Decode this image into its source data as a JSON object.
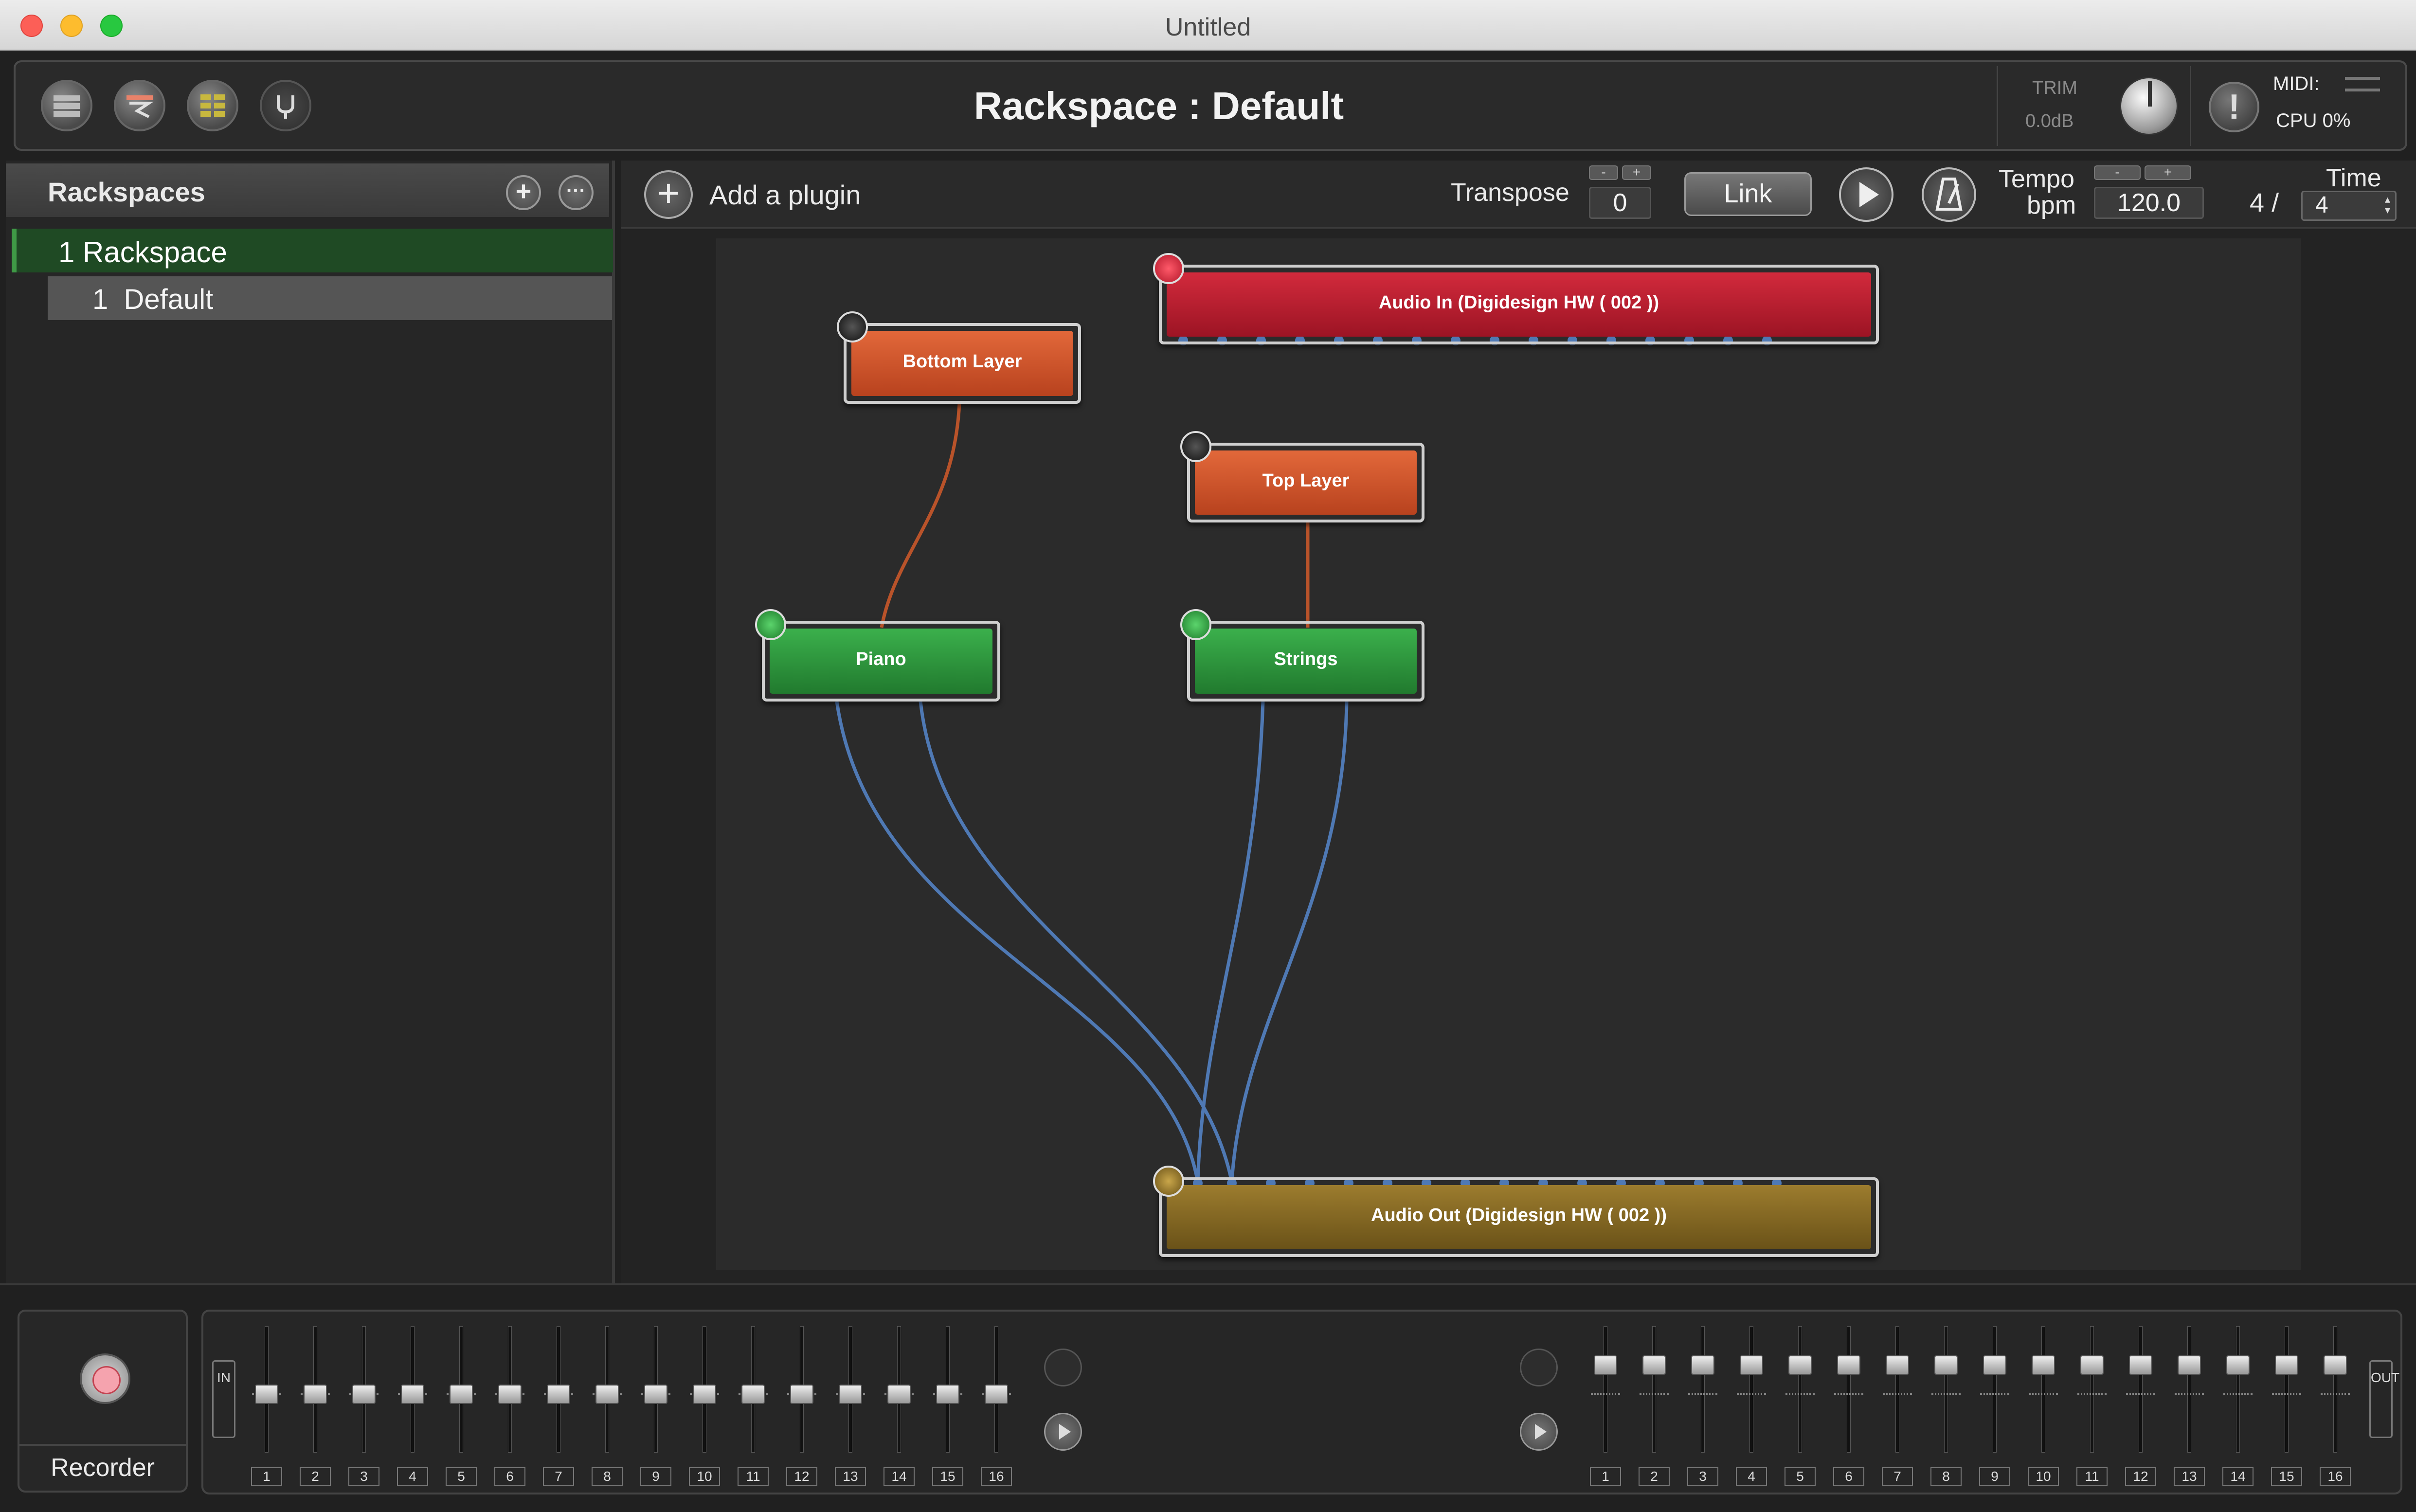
{
  "window": {
    "title": "Untitled"
  },
  "header": {
    "title": "Rackspace : Default",
    "trim_label": "TRIM",
    "trim_value": "0.0dB",
    "midi_label": "MIDI:",
    "cpu_label": "CPU",
    "cpu_value": "0%",
    "icons": [
      "rackspace-view-icon",
      "setlist-view-icon",
      "grid-view-icon",
      "tuner-icon"
    ]
  },
  "sidebar": {
    "title": "Rackspaces",
    "add_button": "+",
    "more_button": "···",
    "rackspaces": [
      {
        "number": "1",
        "name": "Rackspace"
      }
    ],
    "variations": [
      {
        "number": "1",
        "name": "Default"
      }
    ]
  },
  "toolbar": {
    "add_plugin_label": "Add a plugin",
    "transpose_label": "Transpose",
    "transpose_value": "0",
    "minus": "-",
    "plus": "+",
    "link_label": "Link",
    "tempo_label": "Tempo",
    "bpm_label": "bpm",
    "tempo_value": "120.0",
    "time_label": "Time",
    "time_sig_numerator": "4",
    "time_sig_slash": "/",
    "time_sig_denominator": "4"
  },
  "canvas": {
    "nodes": {
      "audio_in": "Audio In (Digidesign HW ( 002 ))",
      "bottom_layer": "Bottom Layer",
      "top_layer": "Top Layer",
      "piano": "Piano",
      "strings": "Strings",
      "audio_out": "Audio Out (Digidesign HW ( 002 ))"
    },
    "colors": {
      "plugin_midi": "#c9502a",
      "instrument": "#2e9a3e",
      "audio_in": "#b61c2e",
      "audio_out": "#84672a",
      "midi_wire": "#b9532a",
      "audio_wire": "#4f79b4"
    }
  },
  "bottom": {
    "recorder_label": "Recorder",
    "in_tag": "IN",
    "out_tag": "OUT",
    "in_channels": [
      "1",
      "2",
      "3",
      "4",
      "5",
      "6",
      "7",
      "8",
      "9",
      "10",
      "11",
      "12",
      "13",
      "14",
      "15",
      "16"
    ],
    "out_channels": [
      "1",
      "2",
      "3",
      "4",
      "5",
      "6",
      "7",
      "8",
      "9",
      "10",
      "11",
      "12",
      "13",
      "14",
      "15",
      "16"
    ]
  }
}
